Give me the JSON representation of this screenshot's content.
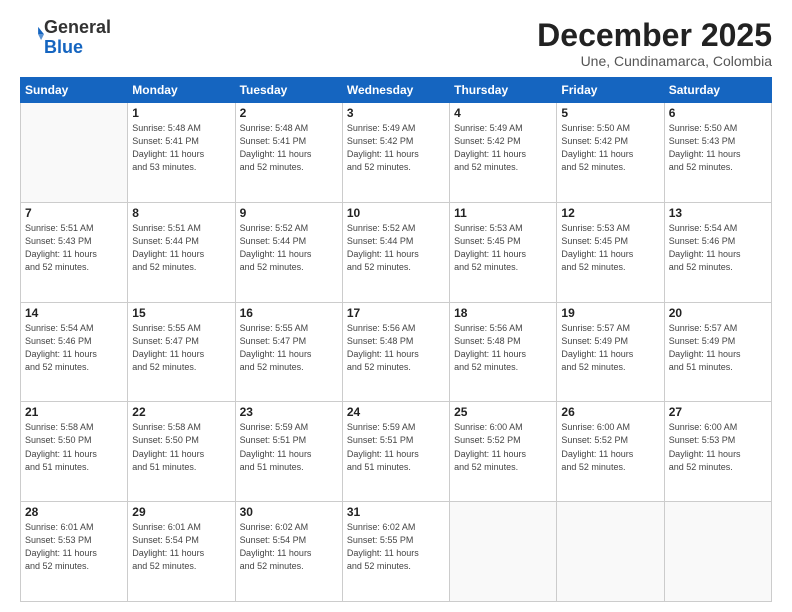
{
  "header": {
    "logo_general": "General",
    "logo_blue": "Blue",
    "month_title": "December 2025",
    "subtitle": "Une, Cundinamarca, Colombia"
  },
  "days_of_week": [
    "Sunday",
    "Monday",
    "Tuesday",
    "Wednesday",
    "Thursday",
    "Friday",
    "Saturday"
  ],
  "weeks": [
    [
      {
        "day": "",
        "info": ""
      },
      {
        "day": "1",
        "info": "Sunrise: 5:48 AM\nSunset: 5:41 PM\nDaylight: 11 hours\nand 53 minutes."
      },
      {
        "day": "2",
        "info": "Sunrise: 5:48 AM\nSunset: 5:41 PM\nDaylight: 11 hours\nand 52 minutes."
      },
      {
        "day": "3",
        "info": "Sunrise: 5:49 AM\nSunset: 5:42 PM\nDaylight: 11 hours\nand 52 minutes."
      },
      {
        "day": "4",
        "info": "Sunrise: 5:49 AM\nSunset: 5:42 PM\nDaylight: 11 hours\nand 52 minutes."
      },
      {
        "day": "5",
        "info": "Sunrise: 5:50 AM\nSunset: 5:42 PM\nDaylight: 11 hours\nand 52 minutes."
      },
      {
        "day": "6",
        "info": "Sunrise: 5:50 AM\nSunset: 5:43 PM\nDaylight: 11 hours\nand 52 minutes."
      }
    ],
    [
      {
        "day": "7",
        "info": "Sunrise: 5:51 AM\nSunset: 5:43 PM\nDaylight: 11 hours\nand 52 minutes."
      },
      {
        "day": "8",
        "info": "Sunrise: 5:51 AM\nSunset: 5:44 PM\nDaylight: 11 hours\nand 52 minutes."
      },
      {
        "day": "9",
        "info": "Sunrise: 5:52 AM\nSunset: 5:44 PM\nDaylight: 11 hours\nand 52 minutes."
      },
      {
        "day": "10",
        "info": "Sunrise: 5:52 AM\nSunset: 5:44 PM\nDaylight: 11 hours\nand 52 minutes."
      },
      {
        "day": "11",
        "info": "Sunrise: 5:53 AM\nSunset: 5:45 PM\nDaylight: 11 hours\nand 52 minutes."
      },
      {
        "day": "12",
        "info": "Sunrise: 5:53 AM\nSunset: 5:45 PM\nDaylight: 11 hours\nand 52 minutes."
      },
      {
        "day": "13",
        "info": "Sunrise: 5:54 AM\nSunset: 5:46 PM\nDaylight: 11 hours\nand 52 minutes."
      }
    ],
    [
      {
        "day": "14",
        "info": "Sunrise: 5:54 AM\nSunset: 5:46 PM\nDaylight: 11 hours\nand 52 minutes."
      },
      {
        "day": "15",
        "info": "Sunrise: 5:55 AM\nSunset: 5:47 PM\nDaylight: 11 hours\nand 52 minutes."
      },
      {
        "day": "16",
        "info": "Sunrise: 5:55 AM\nSunset: 5:47 PM\nDaylight: 11 hours\nand 52 minutes."
      },
      {
        "day": "17",
        "info": "Sunrise: 5:56 AM\nSunset: 5:48 PM\nDaylight: 11 hours\nand 52 minutes."
      },
      {
        "day": "18",
        "info": "Sunrise: 5:56 AM\nSunset: 5:48 PM\nDaylight: 11 hours\nand 52 minutes."
      },
      {
        "day": "19",
        "info": "Sunrise: 5:57 AM\nSunset: 5:49 PM\nDaylight: 11 hours\nand 52 minutes."
      },
      {
        "day": "20",
        "info": "Sunrise: 5:57 AM\nSunset: 5:49 PM\nDaylight: 11 hours\nand 51 minutes."
      }
    ],
    [
      {
        "day": "21",
        "info": "Sunrise: 5:58 AM\nSunset: 5:50 PM\nDaylight: 11 hours\nand 51 minutes."
      },
      {
        "day": "22",
        "info": "Sunrise: 5:58 AM\nSunset: 5:50 PM\nDaylight: 11 hours\nand 51 minutes."
      },
      {
        "day": "23",
        "info": "Sunrise: 5:59 AM\nSunset: 5:51 PM\nDaylight: 11 hours\nand 51 minutes."
      },
      {
        "day": "24",
        "info": "Sunrise: 5:59 AM\nSunset: 5:51 PM\nDaylight: 11 hours\nand 51 minutes."
      },
      {
        "day": "25",
        "info": "Sunrise: 6:00 AM\nSunset: 5:52 PM\nDaylight: 11 hours\nand 52 minutes."
      },
      {
        "day": "26",
        "info": "Sunrise: 6:00 AM\nSunset: 5:52 PM\nDaylight: 11 hours\nand 52 minutes."
      },
      {
        "day": "27",
        "info": "Sunrise: 6:00 AM\nSunset: 5:53 PM\nDaylight: 11 hours\nand 52 minutes."
      }
    ],
    [
      {
        "day": "28",
        "info": "Sunrise: 6:01 AM\nSunset: 5:53 PM\nDaylight: 11 hours\nand 52 minutes."
      },
      {
        "day": "29",
        "info": "Sunrise: 6:01 AM\nSunset: 5:54 PM\nDaylight: 11 hours\nand 52 minutes."
      },
      {
        "day": "30",
        "info": "Sunrise: 6:02 AM\nSunset: 5:54 PM\nDaylight: 11 hours\nand 52 minutes."
      },
      {
        "day": "31",
        "info": "Sunrise: 6:02 AM\nSunset: 5:55 PM\nDaylight: 11 hours\nand 52 minutes."
      },
      {
        "day": "",
        "info": ""
      },
      {
        "day": "",
        "info": ""
      },
      {
        "day": "",
        "info": ""
      }
    ]
  ]
}
